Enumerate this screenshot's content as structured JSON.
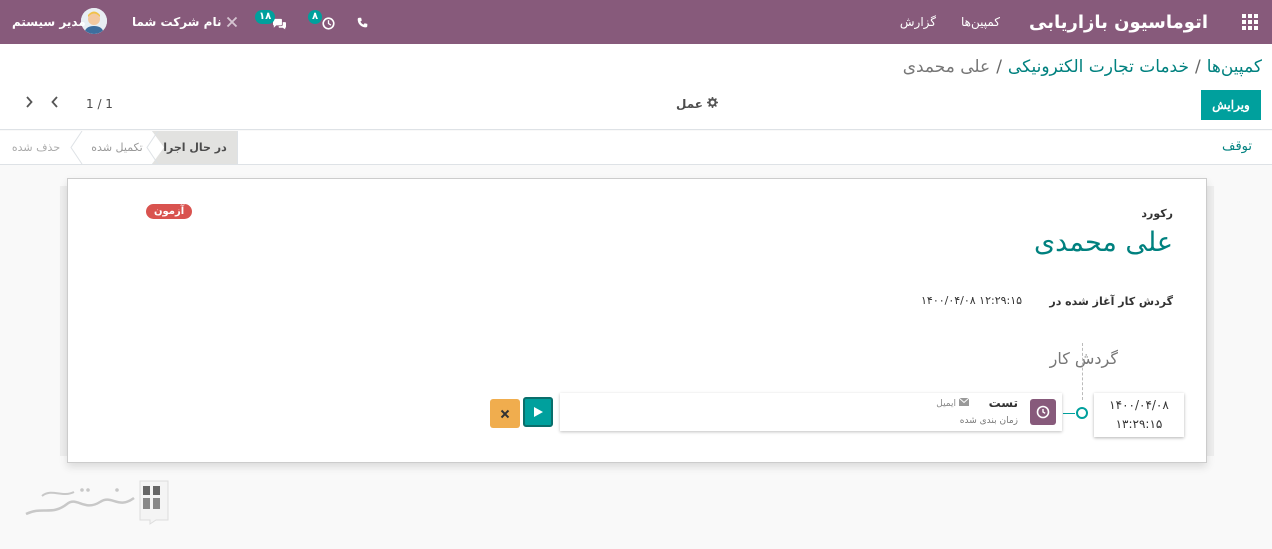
{
  "navbar": {
    "brand": "اتوماسیون بازاریابی",
    "menu_items": [
      "کمپین‌ها",
      "گزارش"
    ],
    "phone_icon": "phone-icon",
    "activity_count": "۸",
    "message_count": "۱۸",
    "debug_icon": "debug-icon",
    "company": "نام شرکت شما",
    "user": "مدیر سیستم"
  },
  "breadcrumb": {
    "items": [
      "کمپین‌ها",
      "خدمات تجارت الکترونیکی"
    ],
    "separator": "/",
    "current": "علی محمدی"
  },
  "toolbar": {
    "edit_label": "ویرایش",
    "action_label": "عمل",
    "pager": "1 / 1"
  },
  "statusbar": {
    "stop_label": "توقف",
    "stages": [
      "در حال اجرا",
      "تکمیل شده",
      "حذف شده"
    ],
    "active_stage": "در حال اجرا"
  },
  "record": {
    "ribbon": "آزمون",
    "label": "رکورد",
    "name": "علی محمدی",
    "started_label": "گردش کار آغاز شده در",
    "started_value": "۱۴۰۰/۰۴/۰۸ ۱۲:۲۹:۱۵"
  },
  "workflow": {
    "title": "گردش کار",
    "date": "۱۴۰۰/۰۴/۰۸",
    "time": "۱۳:۲۹:۱۵",
    "activity_title": "تست",
    "activity_type": "ایمیل",
    "activity_status": "زمان بندی شده"
  },
  "colors": {
    "navbar": "#875a7b",
    "primary": "#00a09d",
    "link": "#00817f",
    "ribbon": "#d9534f",
    "cancel": "#f0ad4e"
  }
}
